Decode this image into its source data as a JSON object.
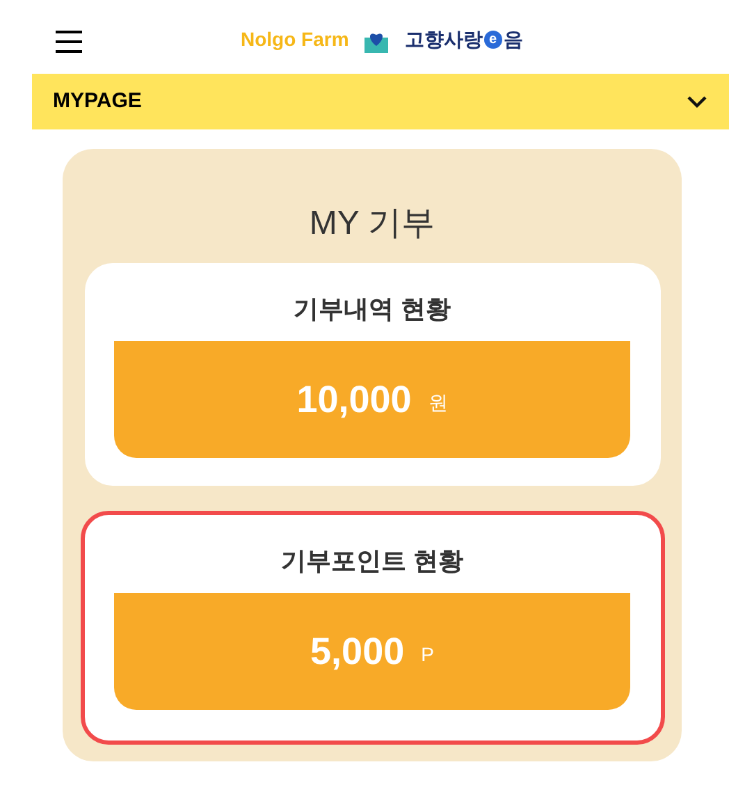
{
  "header": {
    "brand": "Nolgo Farm",
    "partner": [
      "고향사랑",
      "e",
      "음"
    ]
  },
  "menu_bar": {
    "label": "MYPAGE",
    "expanded": false
  },
  "panel": {
    "title": "MY 기부",
    "cards": [
      {
        "title": "기부내역 현황",
        "amount": "10,000",
        "unit": "원",
        "highlighted": false
      },
      {
        "title": "기부포인트 현황",
        "amount": "5,000",
        "unit": "P",
        "highlighted": true
      }
    ]
  }
}
